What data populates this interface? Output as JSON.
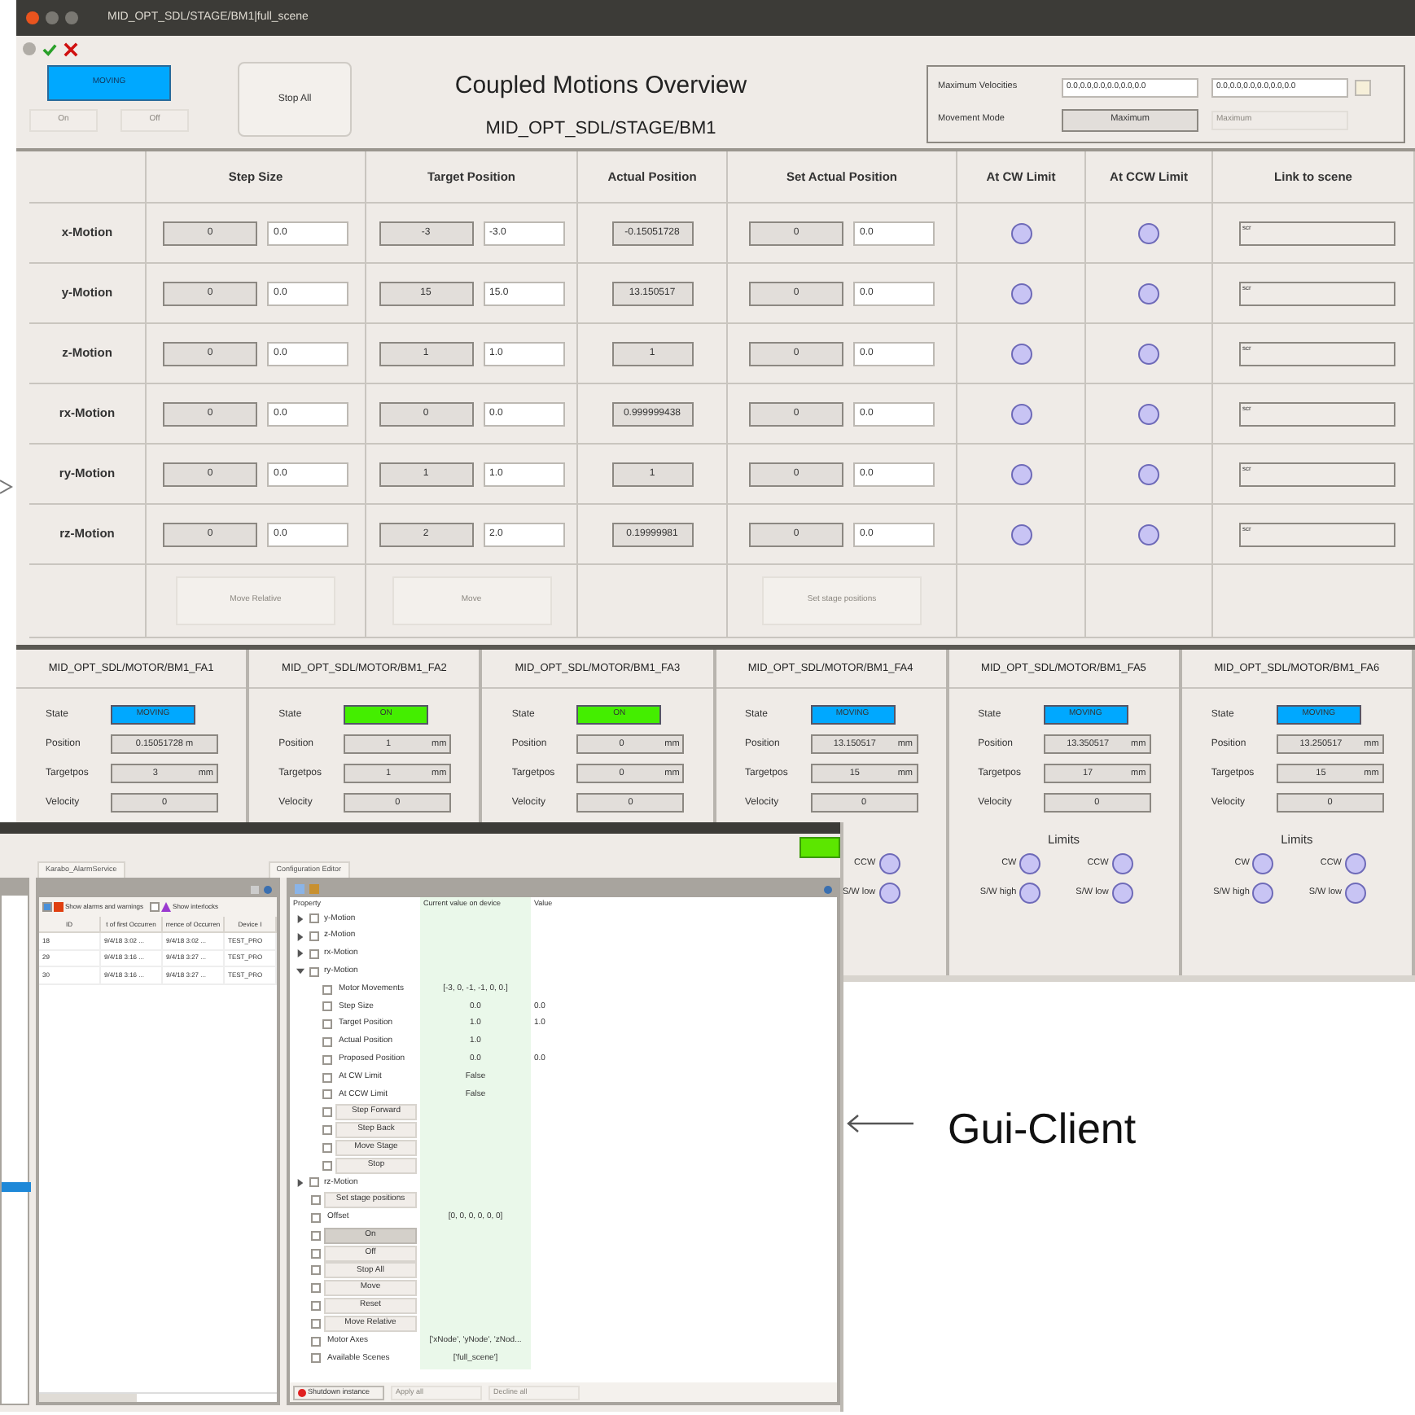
{
  "back_window": {
    "title": "MID_OPT_SDL/STAGE/BM1|full_scene",
    "header": {
      "state_button": {
        "label": "MOVING",
        "color": "#00a8ff"
      },
      "on_button": {
        "label": "On",
        "disabled": true
      },
      "off_button": {
        "label": "Off",
        "disabled": true
      },
      "stop_button": "Stop All",
      "title": "Coupled Motions Overview",
      "subtitle": "MID_OPT_SDL/STAGE/BM1",
      "velocities_label": "Maximum Velocities",
      "velocity_fields": [
        "0.0,0.0,0.0,0.0,0.0,0.0",
        "0.0,0.0,0.0,0.0,0.0,0.0"
      ],
      "mode_label": "Movement Mode",
      "mode_button": "Maximum",
      "mode_dropdown": {
        "value": "Maximum",
        "disabled": true
      }
    },
    "table": {
      "columns": [
        "Step Size",
        "Target Position",
        "Actual Position",
        "Set Actual Position",
        "At CW Limit",
        "At CCW Limit",
        "Link to scene"
      ],
      "rows": [
        {
          "name": "x-Motion",
          "step": [
            "0",
            "0.0"
          ],
          "target": [
            "-3",
            "-3.0"
          ],
          "actual": "-0.15051728",
          "set_actual": [
            "0",
            "0.0"
          ],
          "cw_limit": false,
          "ccw_limit": false,
          "link": "scr"
        },
        {
          "name": "y-Motion",
          "step": [
            "0",
            "0.0"
          ],
          "target": [
            "15",
            "15.0"
          ],
          "actual": "13.150517",
          "set_actual": [
            "0",
            "0.0"
          ],
          "cw_limit": false,
          "ccw_limit": false,
          "link": "scr"
        },
        {
          "name": "z-Motion",
          "step": [
            "0",
            "0.0"
          ],
          "target": [
            "1",
            "1.0"
          ],
          "actual": "1",
          "set_actual": [
            "0",
            "0.0"
          ],
          "cw_limit": false,
          "ccw_limit": false,
          "link": "scr"
        },
        {
          "name": "rx-Motion",
          "step": [
            "0",
            "0.0"
          ],
          "target": [
            "0",
            "0.0"
          ],
          "actual": "0.999999438",
          "set_actual": [
            "0",
            "0.0"
          ],
          "cw_limit": false,
          "ccw_limit": false,
          "link": "scr"
        },
        {
          "name": "ry-Motion",
          "step": [
            "0",
            "0.0"
          ],
          "target": [
            "1",
            "1.0"
          ],
          "actual": "1",
          "set_actual": [
            "0",
            "0.0"
          ],
          "cw_limit": false,
          "ccw_limit": false,
          "link": "scr"
        },
        {
          "name": "rz-Motion",
          "step": [
            "0",
            "0.0"
          ],
          "target": [
            "2",
            "2.0"
          ],
          "actual": "0.19999981",
          "set_actual": [
            "0",
            "0.0"
          ],
          "cw_limit": false,
          "ccw_limit": false,
          "link": "scr"
        }
      ],
      "buttons": [
        {
          "label": "Move Relative",
          "disabled": true
        },
        {
          "label": "Move",
          "disabled": true
        },
        {
          "label": "Set stage positions",
          "disabled": true
        }
      ]
    },
    "motors": [
      {
        "name": "MID_OPT_SDL/MOTOR/BM1_FA1",
        "state": {
          "label": "State",
          "value": "MOVING",
          "color": "#00a8ff"
        },
        "fields": [
          {
            "label": "Position",
            "value": "0.15051728 m"
          },
          {
            "label": "Targetpos",
            "value": "3",
            "unit": "mm"
          },
          {
            "label": "Velocity",
            "value": "0"
          }
        ]
      },
      {
        "name": "MID_OPT_SDL/MOTOR/BM1_FA2",
        "state": {
          "label": "State",
          "value": "ON",
          "color": "#44ee00"
        },
        "fields": [
          {
            "label": "Position",
            "value": "1",
            "unit": "mm"
          },
          {
            "label": "Targetpos",
            "value": "1",
            "unit": "mm"
          },
          {
            "label": "Velocity",
            "value": "0"
          }
        ]
      },
      {
        "name": "MID_OPT_SDL/MOTOR/BM1_FA3",
        "state": {
          "label": "State",
          "value": "ON",
          "color": "#44ee00"
        },
        "fields": [
          {
            "label": "Position",
            "value": "0",
            "unit": "mm"
          },
          {
            "label": "Targetpos",
            "value": "0",
            "unit": "mm"
          },
          {
            "label": "Velocity",
            "value": "0"
          }
        ]
      },
      {
        "name": "MID_OPT_SDL/MOTOR/BM1_FA4",
        "state": {
          "label": "State",
          "value": "MOVING",
          "color": "#00a8ff"
        },
        "fields": [
          {
            "label": "Position",
            "value": "13.150517",
            "unit": "mm"
          },
          {
            "label": "Targetpos",
            "value": "15",
            "unit": "mm"
          },
          {
            "label": "Velocity",
            "value": "0"
          }
        ],
        "limits": {
          "column_2": [
            {
              "label": "CCW",
              "on": false
            },
            {
              "label": "S/W low",
              "on": false
            }
          ]
        }
      },
      {
        "name": "MID_OPT_SDL/MOTOR/BM1_FA5",
        "state": {
          "label": "State",
          "value": "MOVING",
          "color": "#00a8ff"
        },
        "fields": [
          {
            "label": "Position",
            "value": "13.350517",
            "unit": "mm"
          },
          {
            "label": "Targetpos",
            "value": "17",
            "unit": "mm"
          },
          {
            "label": "Velocity",
            "value": "0"
          }
        ],
        "limits": {
          "heading": "Limits",
          "column_1": [
            {
              "label": "CW",
              "on": false
            },
            {
              "label": "S/W high",
              "on": false
            }
          ],
          "column_2": [
            {
              "label": "CCW",
              "on": false
            },
            {
              "label": "S/W low",
              "on": false
            }
          ]
        }
      },
      {
        "name": "MID_OPT_SDL/MOTOR/BM1_FA6",
        "state": {
          "label": "State",
          "value": "MOVING",
          "color": "#00a8ff"
        },
        "fields": [
          {
            "label": "Position",
            "value": "13.250517",
            "unit": "mm"
          },
          {
            "label": "Targetpos",
            "value": "15",
            "unit": "mm"
          },
          {
            "label": "Velocity",
            "value": "0"
          }
        ],
        "limits": {
          "heading": "Limits",
          "column_1": [
            {
              "label": "CW",
              "on": false
            },
            {
              "label": "S/W high",
              "on": false
            }
          ],
          "column_2": [
            {
              "label": "CCW",
              "on": false
            },
            {
              "label": "S/W low",
              "on": false
            }
          ]
        }
      }
    ]
  },
  "front_window": {
    "tabs": [
      {
        "label": "Karabo_AlarmService"
      },
      {
        "label": "Configuration Editor"
      }
    ],
    "alarms": {
      "filters": [
        {
          "label": "Show alarms and warnings",
          "checked": true
        },
        {
          "label": "Show interlocks",
          "checked": false
        }
      ],
      "columns": [
        "ID",
        "t of first Occurren",
        "rrence of Occurren",
        "Device I"
      ],
      "rows": [
        [
          "18",
          "9/4/18 3:02 ...",
          "9/4/18 3:02 ...",
          "TEST_PRO"
        ],
        [
          "29",
          "9/4/18 3:16 ...",
          "9/4/18 3:27 ...",
          "TEST_PRO"
        ],
        [
          "30",
          "9/4/18 3:16 ...",
          "9/4/18 3:27 ...",
          "TEST_PRO"
        ]
      ]
    },
    "config": {
      "columns": [
        "Property",
        "Current value on device",
        "Value"
      ],
      "tree": [
        {
          "kind": "group",
          "label": "y-Motion",
          "expanded": false,
          "checked": false
        },
        {
          "kind": "group",
          "label": "z-Motion",
          "expanded": false,
          "checked": false
        },
        {
          "kind": "group",
          "label": "rx-Motion",
          "expanded": false,
          "checked": false
        },
        {
          "kind": "group",
          "label": "ry-Motion",
          "expanded": true,
          "checked": false,
          "children": [
            {
              "kind": "property",
              "label": "Motor Movements",
              "current": "[-3, 0, -1, -1, 0, 0.]",
              "checked": false
            },
            {
              "kind": "property",
              "label": "Step Size",
              "current": "0.0",
              "value": "0.0",
              "checked": false
            },
            {
              "kind": "property",
              "label": "Target Position",
              "current": "1.0",
              "value": "1.0",
              "checked": false
            },
            {
              "kind": "property",
              "label": "Actual Position",
              "current": "1.0",
              "checked": false
            },
            {
              "kind": "property",
              "label": "Proposed Position",
              "current": "0.0",
              "value": "0.0",
              "checked": false
            },
            {
              "kind": "property",
              "label": "At CW Limit",
              "current": "False",
              "checked": false
            },
            {
              "kind": "property",
              "label": "At CCW Limit",
              "current": "False",
              "checked": false
            },
            {
              "kind": "command",
              "label": "Step Forward",
              "pressed": false,
              "checked": false
            },
            {
              "kind": "command",
              "label": "Step Back",
              "pressed": false,
              "checked": false
            },
            {
              "kind": "command",
              "label": "Move Stage",
              "pressed": false,
              "checked": false
            },
            {
              "kind": "command",
              "label": "Stop",
              "pressed": false,
              "checked": false
            }
          ]
        },
        {
          "kind": "group",
          "label": "rz-Motion",
          "expanded": false,
          "checked": false
        },
        {
          "kind": "command",
          "label": "Set stage positions",
          "pressed": false,
          "checked": false
        },
        {
          "kind": "property",
          "label": "Offset",
          "current": "[0, 0, 0, 0, 0, 0]",
          "checked": false
        },
        {
          "kind": "command",
          "label": "On",
          "pressed": true,
          "checked": false
        },
        {
          "kind": "command",
          "label": "Off",
          "pressed": false,
          "checked": false
        },
        {
          "kind": "command",
          "label": "Stop All",
          "pressed": false,
          "checked": false
        },
        {
          "kind": "command",
          "label": "Move",
          "pressed": false,
          "checked": false
        },
        {
          "kind": "command",
          "label": "Reset",
          "pressed": false,
          "checked": false
        },
        {
          "kind": "command",
          "label": "Move Relative",
          "pressed": false,
          "checked": false
        },
        {
          "kind": "property",
          "label": "Motor Axes",
          "current": "['xNode', 'yNode', 'zNod...",
          "checked": false
        },
        {
          "kind": "property",
          "label": "Available Scenes",
          "current": "['full_scene']",
          "checked": false
        }
      ],
      "footer": [
        {
          "label": "Shutdown instance",
          "disabled": false
        },
        {
          "label": "Apply all",
          "disabled": true
        },
        {
          "label": "Decline all",
          "disabled": true
        }
      ]
    }
  },
  "annotation": {
    "label": "Gui-Client"
  }
}
